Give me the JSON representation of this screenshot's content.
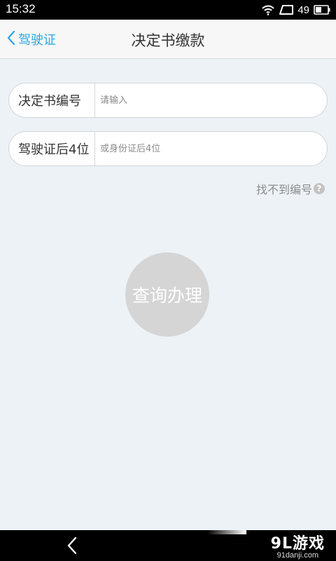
{
  "status_bar": {
    "time": "15:32",
    "battery": "49",
    "icons": [
      "wifi-icon",
      "signal-icon",
      "battery-icon"
    ]
  },
  "nav": {
    "back_label": "驾驶证",
    "title": "决定书缴款"
  },
  "form": {
    "decision_number": {
      "label": "决定书编号",
      "value": "",
      "placeholder": "请输入"
    },
    "license_last4": {
      "label": "驾驶证后4位",
      "value": "",
      "placeholder": "或身份证后4位"
    }
  },
  "help": {
    "label": "找不到编号",
    "icon_text": "?"
  },
  "submit": {
    "label": "查询办理"
  },
  "watermark": {
    "logo": "9L游戏",
    "url": "91danji.com"
  },
  "colors": {
    "accent": "#2ea7e0",
    "background": "#edf2f6",
    "button_disabled": "#d5d5d5"
  }
}
